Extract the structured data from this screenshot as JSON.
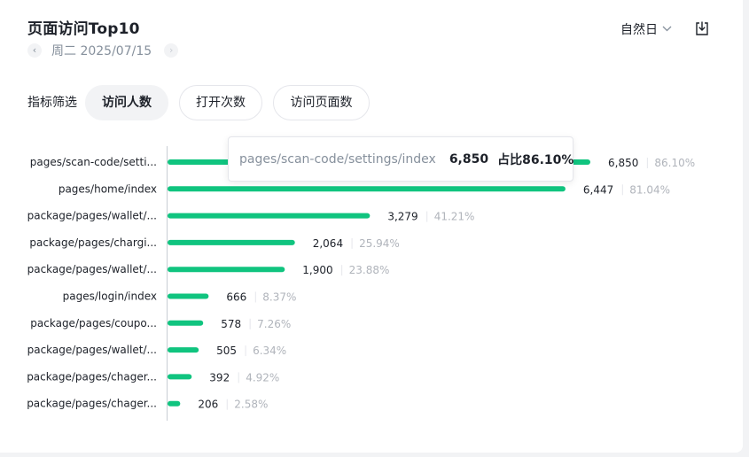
{
  "header": {
    "title": "页面访问Top10",
    "date": "周二 2025/07/15",
    "period_label": "自然日"
  },
  "filters": {
    "label": "指标筛选",
    "options": [
      "访问人数",
      "打开次数",
      "访问页面数"
    ],
    "active": "访问人数"
  },
  "colors": {
    "bar": "#10c47f",
    "axis": "#c9cdd4"
  },
  "chart_data": {
    "type": "bar",
    "orientation": "horizontal",
    "categories": [
      "pages/scan-code/setti...",
      "pages/home/index",
      "package/pages/wallet/...",
      "package/pages/chargi...",
      "package/pages/wallet/...",
      "pages/login/index",
      "package/pages/coupo...",
      "package/pages/wallet/...",
      "package/pages/chager...",
      "package/pages/chager..."
    ],
    "values": [
      6850,
      6447,
      3279,
      2064,
      1900,
      666,
      578,
      505,
      392,
      206
    ],
    "value_labels": [
      "6,850",
      "6,447",
      "3,279",
      "2,064",
      "1,900",
      "666",
      "578",
      "505",
      "392",
      "206"
    ],
    "percents": [
      "86.10%",
      "81.04%",
      "41.21%",
      "25.94%",
      "23.88%",
      "8.37%",
      "7.26%",
      "6.34%",
      "4.92%",
      "2.58%"
    ],
    "xlim": [
      0,
      6850
    ],
    "grid": false,
    "tooltip": {
      "name": "pages/scan-code/settings/index",
      "value": "6,850",
      "percent": "占比86.10%"
    }
  }
}
